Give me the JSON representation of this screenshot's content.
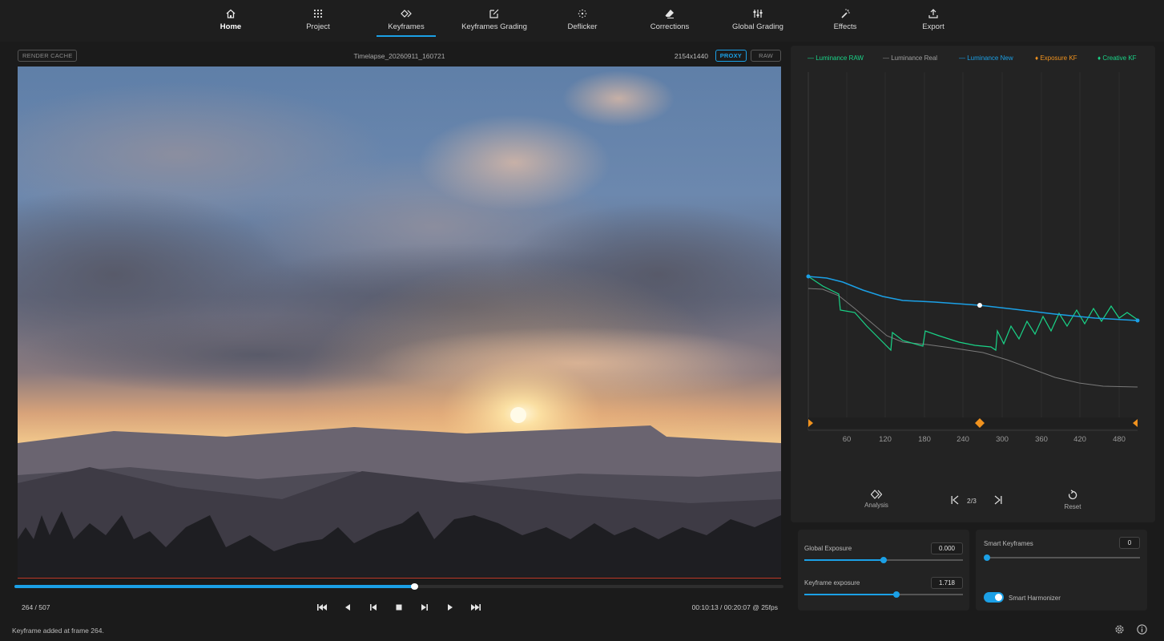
{
  "nav": {
    "items": [
      {
        "label": "Home",
        "icon": "home-icon"
      },
      {
        "label": "Project",
        "icon": "grid-icon"
      },
      {
        "label": "Keyframes",
        "icon": "keyframe-icon"
      },
      {
        "label": "Keyframes Grading",
        "icon": "edit-icon"
      },
      {
        "label": "Deflicker",
        "icon": "sparkle-icon"
      },
      {
        "label": "Corrections",
        "icon": "eraser-icon"
      },
      {
        "label": "Global Grading",
        "icon": "sliders-icon"
      },
      {
        "label": "Effects",
        "icon": "magic-wand-icon"
      },
      {
        "label": "Export",
        "icon": "upload-icon"
      }
    ],
    "active": "Keyframes",
    "accent": "#1ba0e6"
  },
  "viewer": {
    "render_cache": "RENDER CACHE",
    "clip_name": "Timelapse_20260911_160721",
    "resolution": "2154x1440",
    "proxy": "PROXY",
    "raw": "RAW"
  },
  "timeline": {
    "progress": 0.52,
    "frame_label": "264 / 507",
    "timecode": "00:10:13 / 00:20:07 @ 25fps"
  },
  "transport": [
    "skip-start-icon",
    "step-back-icon",
    "prev-frame-icon",
    "stop-icon",
    "next-frame-icon",
    "play-icon",
    "skip-end-icon"
  ],
  "status": "Keyframe added at frame 264.",
  "graph": {
    "legend": [
      {
        "label": "Luminance RAW",
        "color": "#19d488"
      },
      {
        "label": "Luminance Real",
        "color": "#8a8a8a"
      },
      {
        "label": "Luminance New",
        "color": "#1ba0e6"
      },
      {
        "label": "Exposure KF",
        "color": "#f0921e"
      },
      {
        "label": "Creative KF",
        "color": "#19d488"
      }
    ],
    "x_ticks": [
      "60",
      "120",
      "180",
      "240",
      "300",
      "360",
      "420",
      "480"
    ]
  },
  "controls": {
    "analysis": "Analysis",
    "kf_position": "2/3",
    "reset": "Reset"
  },
  "exposure": {
    "global_label": "Global Exposure",
    "global_value": "0.000",
    "global_level": 0.5,
    "keyframe_label": "Keyframe exposure",
    "keyframe_value": "1.718",
    "keyframe_level": 0.58
  },
  "smart": {
    "keyframes_label": "Smart Keyframes",
    "keyframes_value": "0",
    "keyframes_level": 0.0,
    "harmonizer_label": "Smart Harmonizer",
    "harmonizer_on": true
  }
}
